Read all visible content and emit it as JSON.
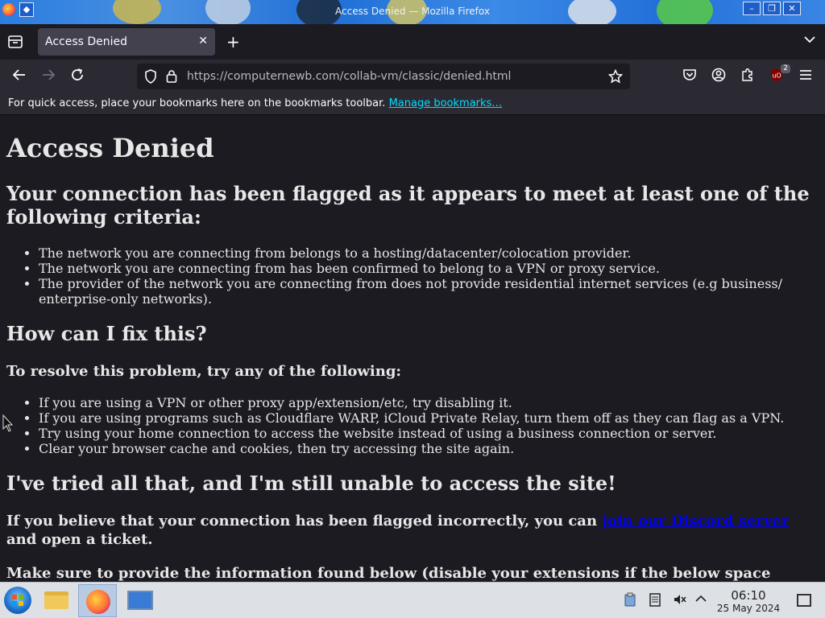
{
  "window": {
    "title": "Access Denied — Mozilla Firefox"
  },
  "tabs": [
    {
      "label": "Access Denied",
      "active": true
    }
  ],
  "nav": {
    "url_host": "https://computernewb.com",
    "url_path": "/collab-vm/classic/denied.html",
    "extension_badge": "2"
  },
  "bookmarks_bar": {
    "prompt": "For quick access, place your bookmarks here on the bookmarks toolbar.",
    "manage_link": "Manage bookmarks…"
  },
  "page": {
    "h1": "Access Denied",
    "criteria_heading": "Your connection has been flagged as it appears to meet at least one of the following criteria:",
    "criteria": [
      "The network you are connecting from belongs to a hosting/datacenter/colocation provider.",
      "The network you are connecting from has been confirmed to belong to a VPN or proxy service.",
      "The provider of the network you are connecting from does not provide residential internet services (e.g business/ enterprise-only networks)."
    ],
    "fix_heading": "How can I fix this?",
    "resolve_heading": "To resolve this problem, try any of the following:",
    "fixes": [
      "If you are using a VPN or other proxy app/extension/etc, try disabling it.",
      "If you are using programs such as Cloudflare WARP, iCloud Private Relay, turn them off as they can flag as a VPN.",
      "Try using your home connection to access the website instead of using a business connection or server.",
      "Clear your browser cache and cookies, then try accessing the site again."
    ],
    "tried_heading": "I've tried all that, and I'm still unable to access the site!",
    "discord_before": "If you believe that your connection has been flagged incorrectly, you can ",
    "discord_link": "join our Discord server",
    "discord_after": " and open a ticket.",
    "info_line": "Make sure to provide the information found below (disable your extensions if the below space"
  },
  "taskbar": {
    "time": "06:10",
    "date": "25 May 2024"
  }
}
